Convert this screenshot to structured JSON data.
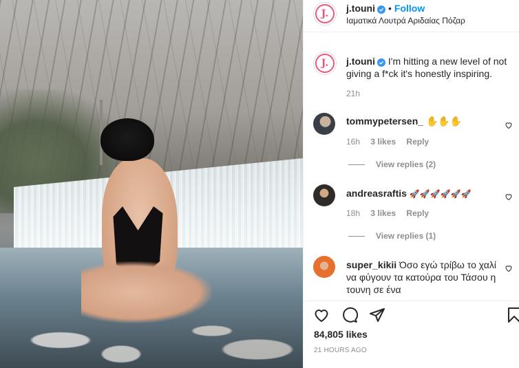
{
  "post": {
    "image_alt": "",
    "author": {
      "username": "j.touni",
      "verified": true,
      "follow_label": "Follow",
      "separator": "•",
      "location": "Ιαματικά Λουτρά Αριδαίας Πόζαρ",
      "avatar_letter": "J."
    },
    "caption": {
      "username": "j.touni",
      "text": "I'm hitting a new level of not giving a f*ck it's honestly inspiring.",
      "time": "21h"
    },
    "comments": [
      {
        "username": "tommypetersen_",
        "text": "✋✋✋",
        "time": "16h",
        "likes": "3 likes",
        "reply_label": "Reply",
        "view_replies": "View replies (2)"
      },
      {
        "username": "andreasraftis",
        "text": "🚀🚀🚀🚀🚀🚀",
        "time": "18h",
        "likes": "3 likes",
        "reply_label": "Reply",
        "view_replies": "View replies (1)"
      },
      {
        "username": "super_kikii",
        "text": "Όσο εγώ τρίβω το χαλί να φύγουν τα κατούρα του Τάσου η τουνη σε ένα"
      }
    ],
    "likes_count": "84,805 likes",
    "posted_ago": "21 HOURS AGO"
  },
  "icons": {
    "verified": "verified-badge-icon",
    "like": "heart-icon",
    "comment": "speech-bubble-icon",
    "share": "paper-plane-icon",
    "save": "bookmark-icon"
  },
  "colors": {
    "follow_blue": "#0095f6",
    "verified_blue": "#3897f0",
    "logo_pink": "#e8587a",
    "muted_text": "#8e8e8e",
    "primary_text": "#262626"
  }
}
